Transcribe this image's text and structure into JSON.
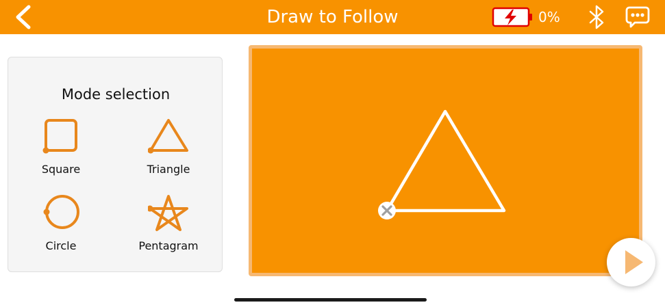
{
  "header": {
    "title": "Draw to Follow",
    "battery_percent": "0%",
    "back_icon": "chevron-left-icon",
    "battery_icon": "battery-charging-icon",
    "bluetooth_icon": "bluetooth-icon",
    "chat_icon": "chat-bubble-icon"
  },
  "mode_panel": {
    "title": "Mode selection",
    "modes": [
      {
        "label": "Square",
        "icon": "square-icon"
      },
      {
        "label": "Triangle",
        "icon": "triangle-icon"
      },
      {
        "label": "Circle",
        "icon": "circle-icon"
      },
      {
        "label": "Pentagram",
        "icon": "pentagram-icon"
      }
    ]
  },
  "canvas": {
    "shape": "triangle",
    "clear_icon": "close-icon"
  },
  "controls": {
    "play_icon": "play-icon"
  },
  "colors": {
    "accent": "#f89200",
    "accent_light": "#f6b872",
    "icon_orange": "#e8871c",
    "battery_red": "#e00000",
    "panel_bg": "#f5f5f5"
  }
}
